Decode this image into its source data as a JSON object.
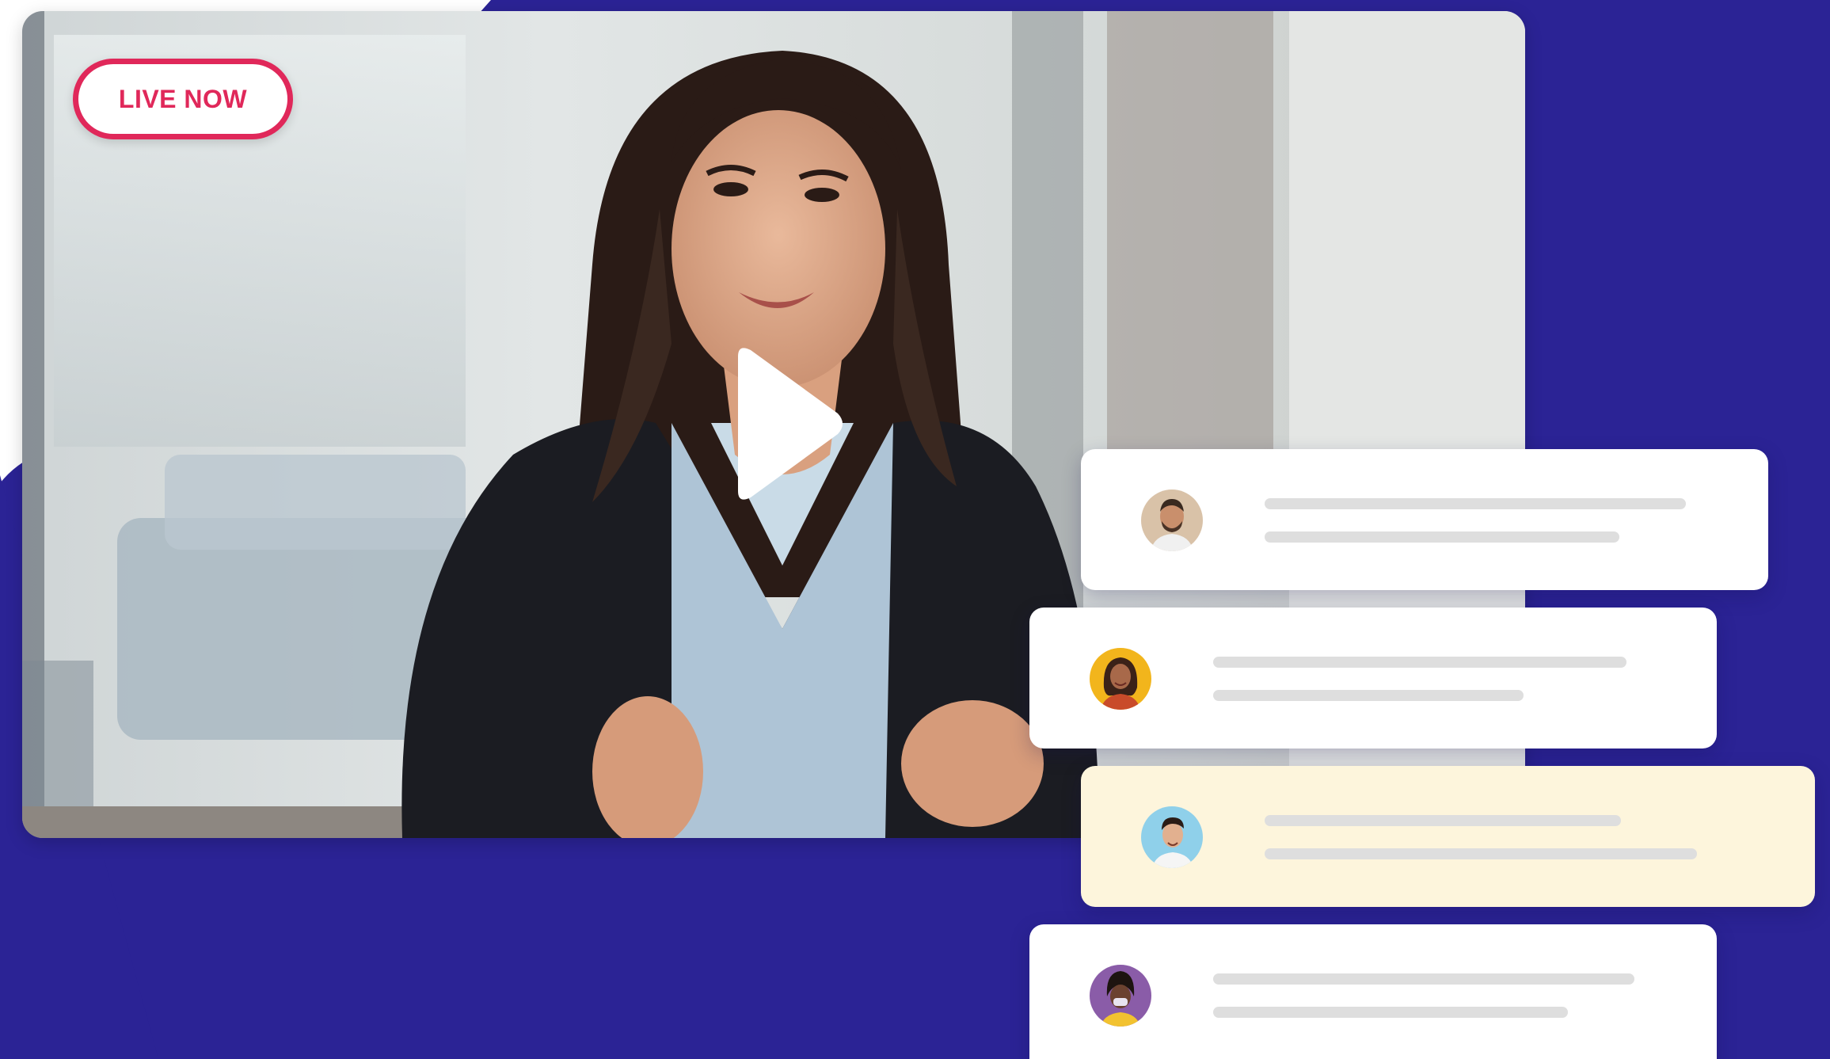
{
  "badge": {
    "label": "LIVE NOW"
  },
  "colors": {
    "backdrop": "#2b2395",
    "badge_accent": "#e0285a",
    "card": "#ffffff",
    "card_highlight": "#fdf5dc",
    "placeholder_line": "#dedede"
  },
  "video": {
    "play_icon": "play-icon"
  },
  "comments": [
    {
      "avatar": "avatar-man-beard",
      "avatar_bg": "#d9c2a8",
      "highlight": false
    },
    {
      "avatar": "avatar-woman-yellow",
      "avatar_bg": "#f2b51c",
      "highlight": false
    },
    {
      "avatar": "avatar-man-blue",
      "avatar_bg": "#8fd0ea",
      "highlight": true
    },
    {
      "avatar": "avatar-woman-purple",
      "avatar_bg": "#8a5ca8",
      "highlight": false
    }
  ]
}
